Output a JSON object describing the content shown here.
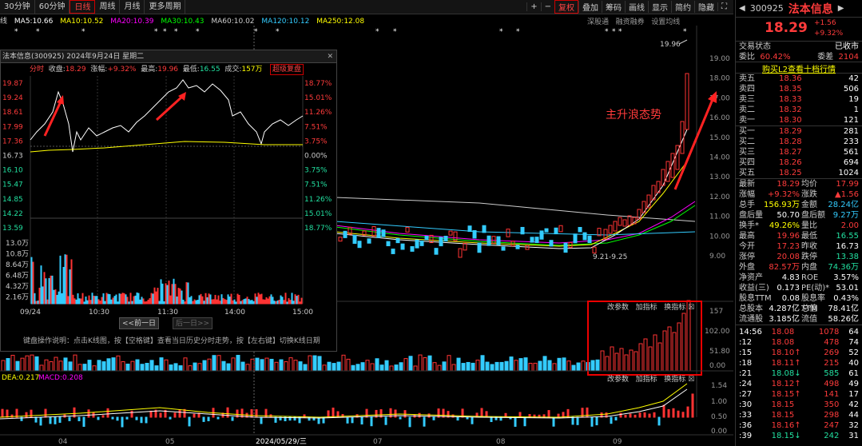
{
  "toolbar": {
    "tabs": [
      "30分钟",
      "60分钟",
      "日线",
      "周线",
      "月线",
      "更多周期"
    ],
    "active": "日线",
    "tools": [
      "复权",
      "叠加",
      "筹码",
      "画线",
      "显示",
      "简约",
      "隐藏"
    ],
    "active_tool": "复权"
  },
  "ma_bar": {
    "prefix": "线",
    "ma5": "MA5:10.66",
    "ma10": "MA10:10.52",
    "ma20": "MA20:10.39",
    "ma30": "MA30:10.43",
    "ma60": "MA60:10.02",
    "ma120": "MA120:10.12",
    "ma250": "MA250:12.08"
  },
  "chart_links": [
    "深股通",
    "融资融券",
    "设置均线"
  ],
  "price_axis": [
    "19.00",
    "18.00",
    "17.00",
    "16.00",
    "15.00",
    "14.00",
    "13.00",
    "12.00",
    "11.00",
    "10.00",
    "9.00"
  ],
  "high_label": "19.96",
  "low_label": "9.21-9.25",
  "annotation": "主升浪态势",
  "vol_axis": [
    "157",
    "102.00",
    "51.80",
    "0.00"
  ],
  "macd_axis": [
    "1.54",
    "1.00",
    "0.50",
    "0.00"
  ],
  "indicator_tools": [
    "改参数",
    "加指标",
    "换指标"
  ],
  "macd_label": {
    "dea": "DEA:0.217",
    "macd": "MACD:0.208"
  },
  "date_axis": [
    "04",
    "05",
    "2024/05/29/三",
    "07",
    "08",
    "09"
  ],
  "popup": {
    "title": "法本信息(300925) 2024年9月24日 星期二",
    "header": {
      "kind": "分时",
      "close_lbl": "收盘:",
      "close": "18.29",
      "chg_lbl": "涨幅:",
      "chg": "+9.32%",
      "high_lbl": "最高:",
      "high": "19.96",
      "low_lbl": "最低:",
      "low": "16.55",
      "vol_lbl": "成交:",
      "vol": "157万",
      "btn": "超级复盘"
    },
    "left_axis": [
      "19.87",
      "19.24",
      "18.61",
      "17.99",
      "17.36",
      "16.73",
      "16.10",
      "15.47",
      "14.85",
      "14.22",
      "13.59"
    ],
    "right_axis": [
      "18.77%",
      "15.01%",
      "11.26%",
      "7.51%",
      "3.75%",
      "0.00%",
      "3.75%",
      "7.51%",
      "11.26%",
      "15.01%",
      "18.77%"
    ],
    "vol_axis": [
      "13.0万",
      "10.8万",
      "8.64万",
      "6.48万",
      "4.32万",
      "2.16万"
    ],
    "time_axis": [
      "09/24",
      "10:30",
      "11:30",
      "14:00",
      "15:00"
    ],
    "prev": "<<前一日",
    "next": "后一日>>",
    "help": "键盘操作说明：点击K线图，按【空格键】查看当日历史分时走势，按【左右键】切换K线日期"
  },
  "quote": {
    "code": "300925",
    "name": "法本信息",
    "price": "18.29",
    "change": "+1.56",
    "pct": "+9.32%",
    "status_lbl": "交易状态",
    "status": "已收市",
    "wb_lbl": "委比",
    "wb": "60.42%",
    "wc_lbl": "委差",
    "wc": "2104",
    "l2": "购买L2查看十档行情",
    "asks": [
      {
        "l": "卖五",
        "p": "18.36",
        "v": "42"
      },
      {
        "l": "卖四",
        "p": "18.35",
        "v": "506"
      },
      {
        "l": "卖三",
        "p": "18.33",
        "v": "19"
      },
      {
        "l": "卖二",
        "p": "18.32",
        "v": "1"
      },
      {
        "l": "卖一",
        "p": "18.30",
        "v": "121"
      }
    ],
    "bids": [
      {
        "l": "买一",
        "p": "18.29",
        "v": "281"
      },
      {
        "l": "买二",
        "p": "18.28",
        "v": "233"
      },
      {
        "l": "买三",
        "p": "18.27",
        "v": "561"
      },
      {
        "l": "买四",
        "p": "18.26",
        "v": "694"
      },
      {
        "l": "买五",
        "p": "18.25",
        "v": "1024"
      }
    ],
    "stats": [
      [
        "最新",
        "18.29",
        "red",
        "均价",
        "17.99",
        "red"
      ],
      [
        "涨幅",
        "+9.32%",
        "red",
        "涨跌",
        "▲1.56",
        "red"
      ],
      [
        "总手",
        "156.93万",
        "yel",
        "金额",
        "28.24亿",
        "cyan"
      ],
      [
        "盘后量",
        "50.70",
        "wht",
        "盘后额",
        "9.27万",
        "cyan"
      ],
      [
        "换手*",
        "49.26%",
        "yel",
        "量比",
        "2.00",
        "red"
      ],
      [
        "最高",
        "19.96",
        "red",
        "最低",
        "16.55",
        "green"
      ],
      [
        "今开",
        "17.23",
        "red",
        "昨收",
        "16.73",
        "wht"
      ],
      [
        "涨停",
        "20.08",
        "red",
        "跌停",
        "13.38",
        "green"
      ],
      [
        "外盘",
        "82.57万",
        "red",
        "内盘",
        "74.36万",
        "green"
      ],
      [
        "净资产",
        "4.83",
        "wht",
        "ROE",
        "3.57%",
        "wht"
      ],
      [
        "收益(三)",
        "0.173",
        "wht",
        "PE(动)*",
        "53.01",
        "wht"
      ],
      [
        "股息TTM",
        "0.08",
        "wht",
        "股息率TTM",
        "0.43%",
        "wht"
      ],
      [
        "总股本",
        "4.287亿",
        "wht",
        "总值",
        "78.41亿",
        "wht"
      ],
      [
        "流通股",
        "3.185亿",
        "wht",
        "流值",
        "58.26亿",
        "wht"
      ]
    ],
    "ticks": [
      {
        "t": "14:56",
        "p": "18.08",
        "v": "1078",
        "n": "64",
        "c": "red"
      },
      {
        "t": ":12",
        "p": "18.08",
        "v": "478",
        "n": "74",
        "c": "red"
      },
      {
        "t": ":15",
        "p": "18.10↑",
        "v": "269",
        "n": "52",
        "c": "red"
      },
      {
        "t": ":18",
        "p": "18.11↑",
        "v": "215",
        "n": "40",
        "c": "red"
      },
      {
        "t": ":21",
        "p": "18.08↓",
        "v": "585",
        "n": "61",
        "c": "green"
      },
      {
        "t": ":24",
        "p": "18.12↑",
        "v": "498",
        "n": "49",
        "c": "red"
      },
      {
        "t": ":27",
        "p": "18.15↑",
        "v": "141",
        "n": "17",
        "c": "red"
      },
      {
        "t": ":30",
        "p": "18.15",
        "v": "350",
        "n": "42",
        "c": "red"
      },
      {
        "t": ":33",
        "p": "18.15",
        "v": "298",
        "n": "44",
        "c": "red"
      },
      {
        "t": ":36",
        "p": "18.16↑",
        "v": "247",
        "n": "32",
        "c": "red"
      },
      {
        "t": ":39",
        "p": "18.15↓",
        "v": "242",
        "n": "31",
        "c": "green"
      }
    ]
  }
}
